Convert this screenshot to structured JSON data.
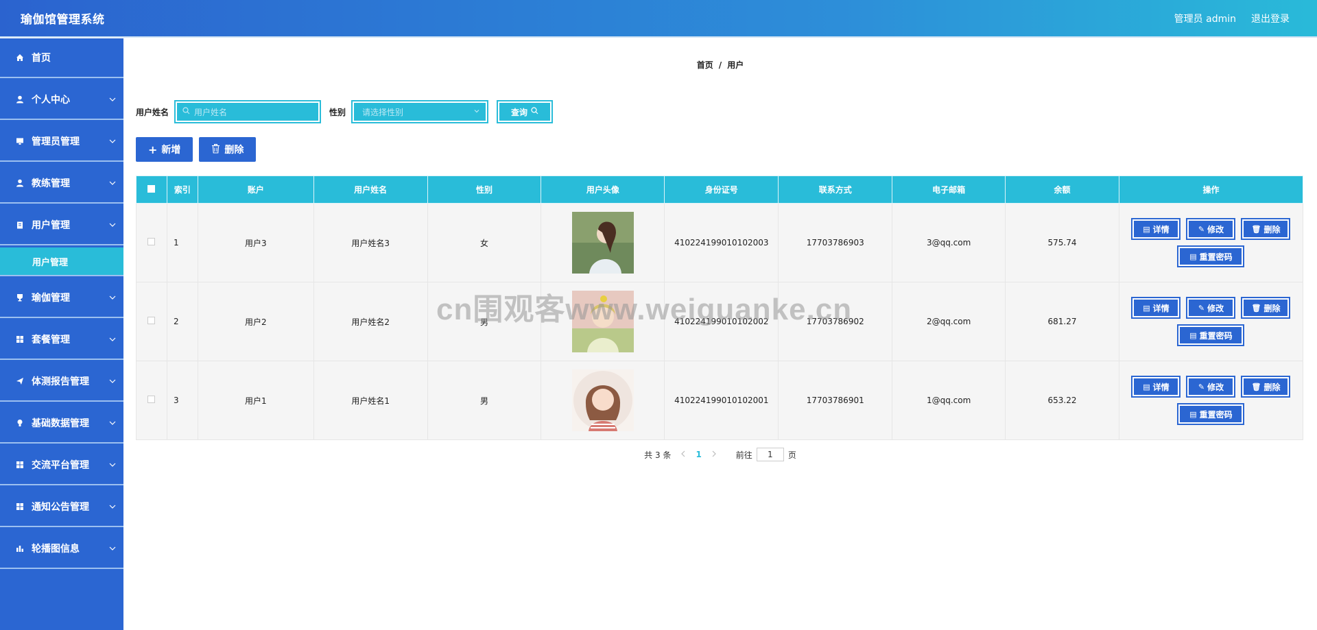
{
  "header": {
    "title": "瑜伽馆管理系统",
    "admin": "管理员 admin",
    "logout": "退出登录"
  },
  "sidebar": {
    "items": [
      {
        "label": "首页",
        "icon": "home-icon"
      },
      {
        "label": "个人中心",
        "icon": "user-icon"
      },
      {
        "label": "管理员管理",
        "icon": "monitor-icon"
      },
      {
        "label": "教练管理",
        "icon": "user-icon"
      },
      {
        "label": "用户管理",
        "icon": "clipboard-icon"
      },
      {
        "label": "瑜伽管理",
        "icon": "trophy-icon"
      },
      {
        "label": "套餐管理",
        "icon": "grid-icon"
      },
      {
        "label": "体测报告管理",
        "icon": "send-icon"
      },
      {
        "label": "基础数据管理",
        "icon": "bulb-icon"
      },
      {
        "label": "交流平台管理",
        "icon": "grid-icon"
      },
      {
        "label": "通知公告管理",
        "icon": "grid-icon"
      },
      {
        "label": "轮播图信息",
        "icon": "chart-icon"
      }
    ],
    "sub_active": "用户管理"
  },
  "breadcrumb": {
    "home": "首页",
    "sep": "/",
    "current": "用户"
  },
  "filters": {
    "name_label": "用户姓名",
    "name_placeholder": "用户姓名",
    "gender_label": "性别",
    "gender_placeholder": "请选择性别",
    "query": "查询"
  },
  "actions": {
    "add": "新增",
    "delete": "删除"
  },
  "table": {
    "headers": [
      "索引",
      "账户",
      "用户姓名",
      "性别",
      "用户头像",
      "身份证号",
      "联系方式",
      "电子邮箱",
      "余额",
      "操作"
    ],
    "rows": [
      {
        "index": "1",
        "account": "用户3",
        "name": "用户姓名3",
        "gender": "女",
        "id_card": "410224199010102003",
        "phone": "17703786903",
        "email": "3@qq.com",
        "balance": "575.74"
      },
      {
        "index": "2",
        "account": "用户2",
        "name": "用户姓名2",
        "gender": "男",
        "id_card": "410224199010102002",
        "phone": "17703786902",
        "email": "2@qq.com",
        "balance": "681.27"
      },
      {
        "index": "3",
        "account": "用户1",
        "name": "用户姓名1",
        "gender": "男",
        "id_card": "410224199010102001",
        "phone": "17703786901",
        "email": "1@qq.com",
        "balance": "653.22"
      }
    ],
    "ops": {
      "detail": "详情",
      "edit": "修改",
      "delete": "删除",
      "reset": "重置密码"
    }
  },
  "pager": {
    "total": "共 3 条",
    "current": "1",
    "goto_label": "前往",
    "page_value": "1",
    "page_suffix": "页"
  },
  "watermark": "cn围观客www.weiguanke.cn",
  "colors": {
    "primary": "#2b66d2",
    "accent": "#29bcd9"
  }
}
